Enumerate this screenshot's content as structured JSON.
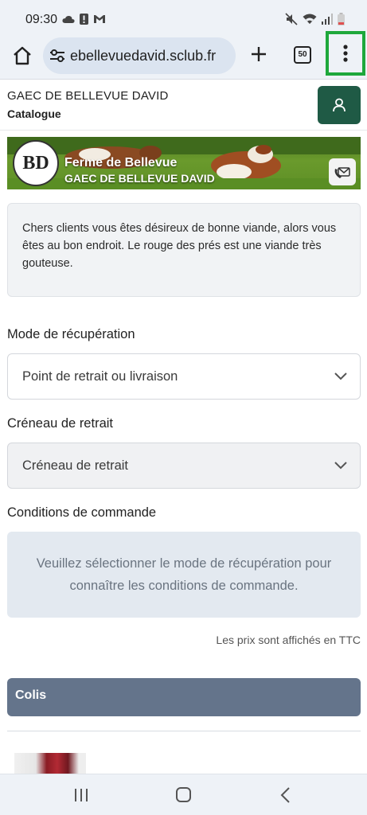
{
  "status_bar": {
    "time": "09:30",
    "left_icons": [
      "cloud-icon",
      "alert-icon",
      "gmail-icon"
    ],
    "right_icons": [
      "mute-icon",
      "wifi-icon",
      "signal-icon",
      "battery-icon"
    ]
  },
  "browser": {
    "url": "ebellevuedavid.sclub.fr",
    "tab_count": "50",
    "icons": [
      "home-icon",
      "site-settings-icon",
      "new-tab-icon",
      "tabs-icon",
      "menu-icon"
    ],
    "highlight_color": "#1ea83b"
  },
  "header": {
    "shop_name": "GAEC DE BELLEVUE DAVID",
    "page_label": "Catalogue",
    "account_color": "#1f5a45"
  },
  "banner": {
    "logo_text": "BD",
    "title": "Ferme de Bellevue",
    "subtitle": "GAEC DE BELLEVUE DAVID"
  },
  "intro": {
    "text": "Chers clients vous êtes désireux de bonne viande, alors vous êtes au bon endroit. Le rouge des prés est une viande très gouteuse."
  },
  "pickup": {
    "label": "Mode de récupération",
    "value": "Point de retrait ou livraison"
  },
  "slot": {
    "label": "Créneau de retrait",
    "value": "Créneau de retrait"
  },
  "conditions": {
    "label": "Conditions de commande",
    "message": "Veuillez sélectionner le mode de récupération pour connaître les conditions de commande."
  },
  "price_note": "Les prix sont affichés en TTC",
  "category": {
    "label": "Colis",
    "color": "#64748b"
  },
  "nav_bar": {
    "icons": [
      "recents-icon",
      "home-nav-icon",
      "back-icon"
    ]
  }
}
